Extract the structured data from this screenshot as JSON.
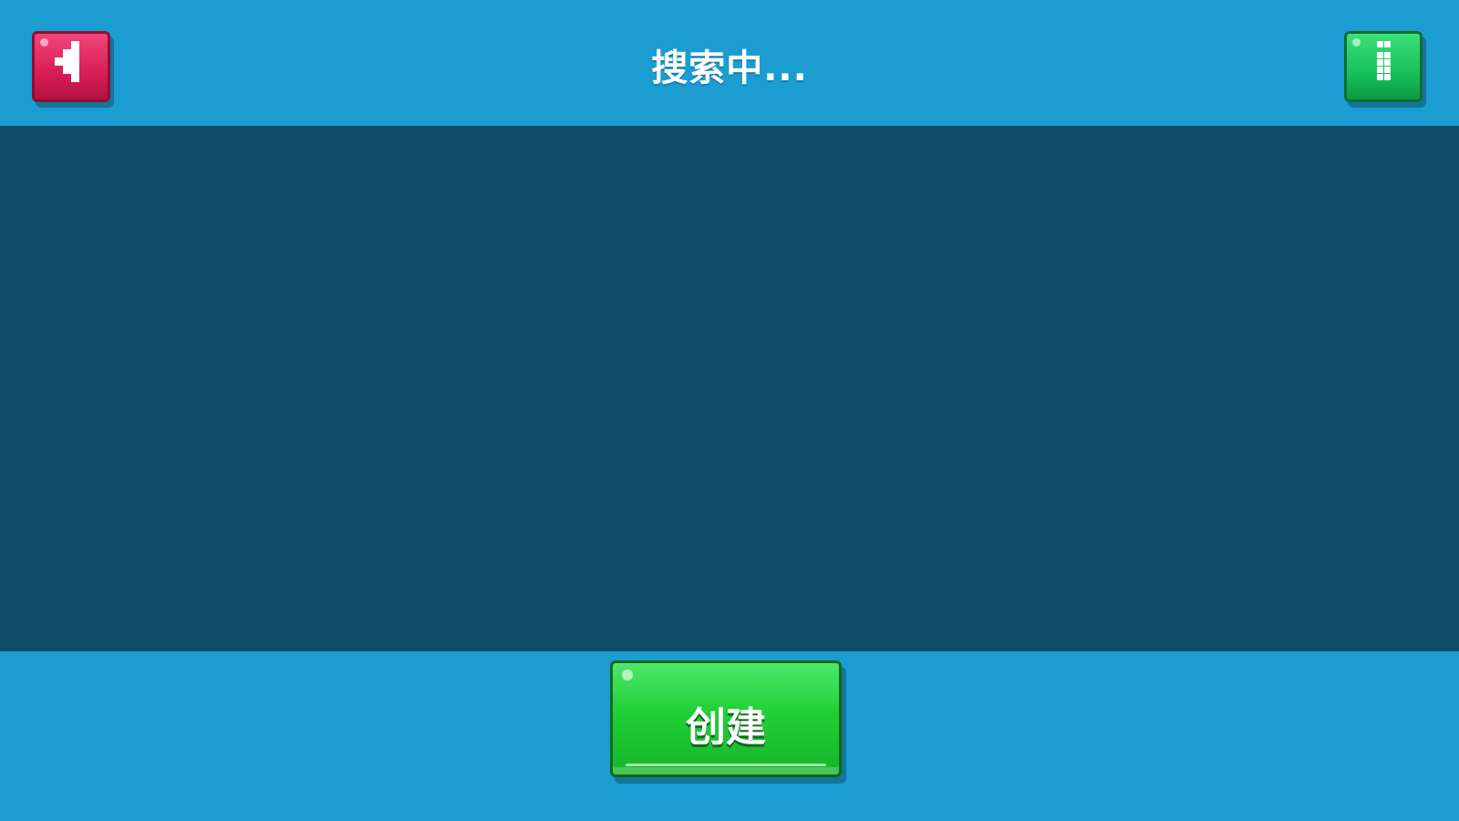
{
  "header": {
    "title": "搜索中..."
  },
  "buttons": {
    "back": {
      "icon": "back-arrow-icon",
      "color": "#d81d57"
    },
    "info": {
      "icon": "info-icon",
      "color": "#15c05a"
    },
    "create": {
      "label": "创建",
      "color": "#1fcf35"
    }
  },
  "colors": {
    "bar_background": "#1b9dd1",
    "list_background": "#0e4c69"
  }
}
